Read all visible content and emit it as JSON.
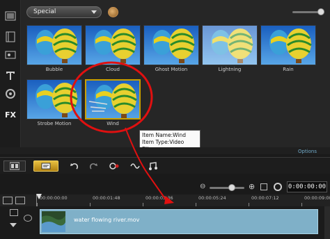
{
  "library": {
    "category_label": "Special",
    "thumbnails": [
      {
        "label": "Bubble"
      },
      {
        "label": "Cloud"
      },
      {
        "label": "Ghost Motion"
      },
      {
        "label": "Lightning"
      },
      {
        "label": "Rain"
      },
      {
        "label": "Strobe Motion"
      },
      {
        "label": "Wind"
      }
    ],
    "options_label": "Options"
  },
  "tooltip": {
    "line1": "Item Name:Wind",
    "line2": "Item Type:Video Filter"
  },
  "timeline": {
    "timecode": "0:00:00:00",
    "ruler_labels": [
      "00:00:00:00",
      "00:00:01:48",
      "00:00:03:36",
      "00:00:05:24",
      "00:00:07:12",
      "00:00:09:00"
    ],
    "clip_name": "water flowing river.mov"
  },
  "colors": {
    "selection": "#c9a000",
    "annotation": "#e01010",
    "clip": "#7fb0c8"
  }
}
